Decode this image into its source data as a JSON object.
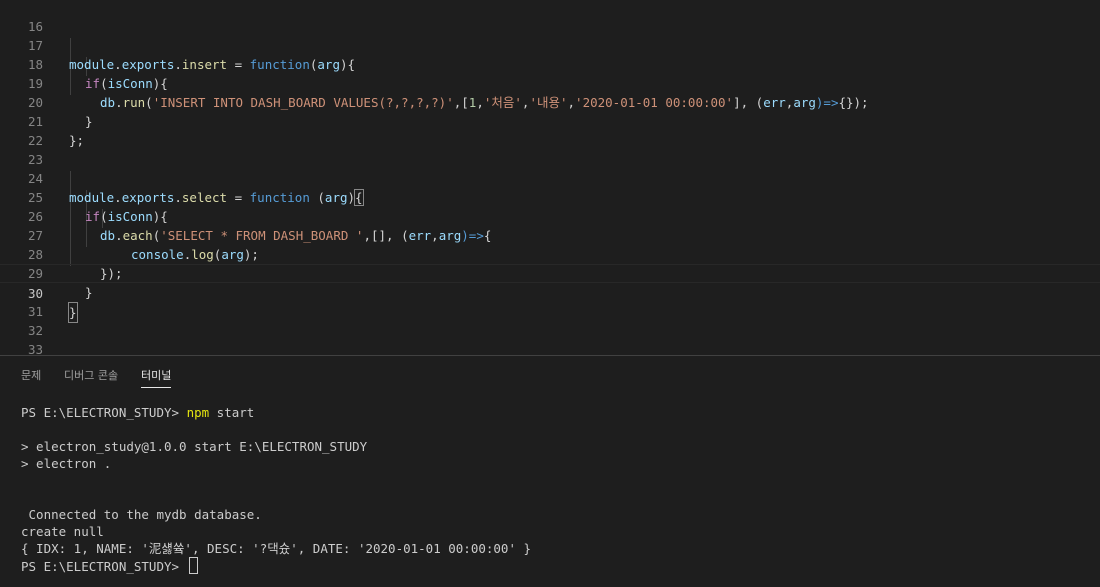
{
  "editor": {
    "line_numbers": [
      "16",
      "17",
      "18",
      "19",
      "20",
      "21",
      "22",
      "23",
      "24",
      "25",
      "26",
      "27",
      "28",
      "29",
      "30",
      "31",
      "32",
      "33"
    ],
    "code": {
      "l17": {
        "module": "module",
        "dot1": ".",
        "exports": "exports",
        "dot2": ".",
        "insert": "insert",
        "eq": " = ",
        "function": "function",
        "paren": "(",
        "arg": "arg",
        "close": "){"
      },
      "l18": {
        "if": "if",
        "open": "(",
        "isConn": "isConn",
        "close": "){"
      },
      "l19": {
        "db": "db",
        "dot": ".",
        "run": "run",
        "open": "(",
        "sql": "'INSERT INTO DASH_BOARD VALUES(?,?,?,?)'",
        "comma1": ",[",
        "one": "1",
        "comma2": ",",
        "s1": "'처음'",
        "comma3": ",",
        "s2": "'내용'",
        "comma4": ",",
        "s3": "'2020-01-01 00:00:00'",
        "close_arr": "], (",
        "err": "err",
        "comma5": ",",
        "arg": "arg",
        "arrow": ")=>",
        "tail": "{});"
      },
      "l20": {
        "brace": "}"
      },
      "l21": {
        "brace": "};"
      },
      "l24": {
        "module": "module",
        "dot1": ".",
        "exports": "exports",
        "dot2": ".",
        "select": "select",
        "eq": " = ",
        "function": "function",
        "sp": " (",
        "arg": "arg",
        "close": ")",
        "brace": "{"
      },
      "l25": {
        "if": "if",
        "open": "(",
        "isConn": "isConn",
        "close": "){"
      },
      "l26": {
        "db": "db",
        "dot": ".",
        "each": "each",
        "open": "(",
        "sql": "'SELECT * FROM DASH_BOARD '",
        "mid": ",[], (",
        "err": "err",
        "comma": ",",
        "arg": "arg",
        "arrow": ")=>",
        "brace": "{"
      },
      "l27": {
        "console": "console",
        "dot": ".",
        "log": "log",
        "open": "(",
        "arg": "arg",
        "close": ");"
      },
      "l28": {
        "text": "});"
      },
      "l29": {
        "brace": "}"
      },
      "l30": {
        "brace": "}"
      }
    }
  },
  "panel": {
    "tabs": [
      {
        "label": "문제"
      },
      {
        "label": "디버그 콘솔"
      },
      {
        "label": "터미널"
      }
    ],
    "active_tab": "터미널",
    "terminal": {
      "prompt1": "PS E:\\ELECTRON_STUDY> ",
      "cmd1_npm": "npm",
      "cmd1_rest": " start",
      "out1": "> electron_study@1.0.0 start E:\\ELECTRON_STUDY",
      "out2": "> electron .",
      "out3": " Connected to the mydb database.",
      "out4": "create null",
      "out5": "{ IDX: 1, NAME: '泥섏쓬', DESC: '?댁슜', DATE: '2020-01-01 00:00:00' }",
      "prompt2": "PS E:\\ELECTRON_STUDY> "
    }
  },
  "colors": {
    "background": "#1e1e1e",
    "keyword_control": "#c586c0",
    "keyword": "#569cd6",
    "function": "#dcdcaa",
    "variable": "#9cdcfe",
    "string": "#ce9178",
    "number": "#b5cea8",
    "terminal_command": "#e5e510"
  }
}
